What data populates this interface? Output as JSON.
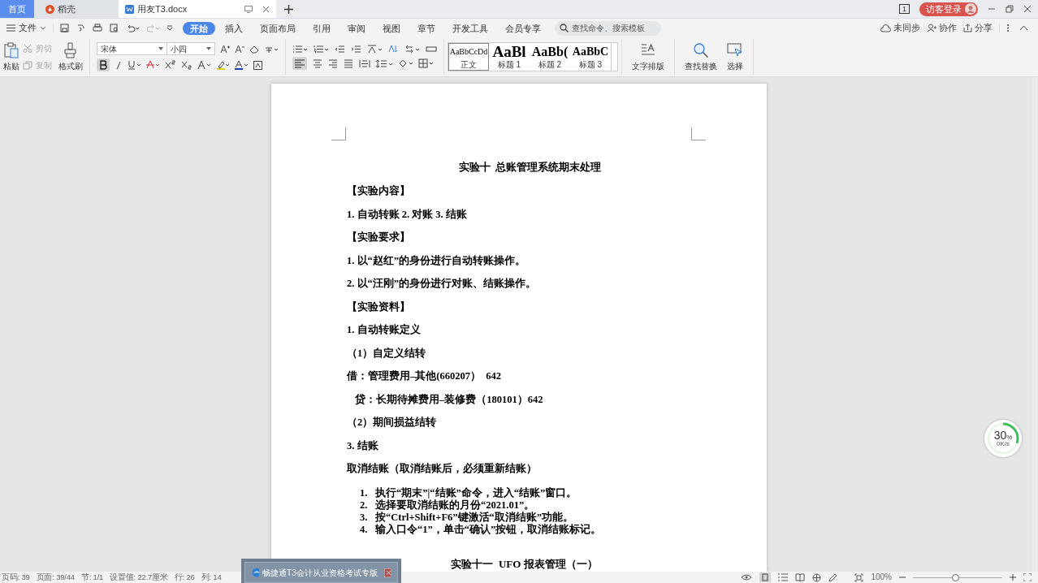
{
  "title_tabs": [
    {
      "label": "首页",
      "kind": "home",
      "selected": false
    },
    {
      "label": "稻壳",
      "kind": "docer",
      "selected": false
    },
    {
      "label": "用友T3.docx",
      "kind": "doc",
      "selected": true
    }
  ],
  "account": {
    "label": "访客登录",
    "page_count": "1"
  },
  "menu": {
    "file": "文件",
    "tabs": [
      {
        "label": "开始",
        "selected": true
      },
      {
        "label": "插入",
        "selected": false
      },
      {
        "label": "页面布局",
        "selected": false
      },
      {
        "label": "引用",
        "selected": false
      },
      {
        "label": "审阅",
        "selected": false
      },
      {
        "label": "视图",
        "selected": false
      },
      {
        "label": "章节",
        "selected": false
      },
      {
        "label": "开发工具",
        "selected": false
      },
      {
        "label": "会员专享",
        "selected": false
      }
    ],
    "search_placeholder": "查找命令、搜索模板",
    "actions": [
      "未同步",
      "协作",
      "分享"
    ]
  },
  "ribbon": {
    "paste": "粘贴",
    "cut": "剪切",
    "copy": "复制",
    "format_painter": "格式刷",
    "font": "宋体",
    "size": "小四",
    "styles": [
      {
        "preview": "AaBbCcDd",
        "label": "正文",
        "selected": true
      },
      {
        "preview": "AaBl",
        "label": "标题 1",
        "selected": false
      },
      {
        "preview": "AaBb(",
        "label": "标题 2",
        "selected": false
      },
      {
        "preview": "AaBbC",
        "label": "标题 3",
        "selected": false
      }
    ],
    "layout": "文字排版",
    "find": "查找替换",
    "select": "选择"
  },
  "document": [
    {
      "kind": "title",
      "text": "实验十  总账管理系统期末处理"
    },
    {
      "kind": "para",
      "text": "【实验内容】"
    },
    {
      "kind": "para",
      "text": "1. 自动转账 2. 对账 3. 结账"
    },
    {
      "kind": "para",
      "text": "【实验要求】"
    },
    {
      "kind": "para",
      "text": "1. 以“赵红”的身份进行自动转账操作。"
    },
    {
      "kind": "para",
      "text": "2. 以“汪刚”的身份进行对账、结账操作。"
    },
    {
      "kind": "para",
      "text": "【实验资料】"
    },
    {
      "kind": "para",
      "text": "1. 自动转账定义"
    },
    {
      "kind": "para",
      "text": "（1）自定义结转"
    },
    {
      "kind": "para",
      "text": "借：管理费用–其他(660207）  642"
    },
    {
      "kind": "indent",
      "text": "贷：长期待摊费用–装修费（180101）642"
    },
    {
      "kind": "para",
      "text": "（2）期间损益结转"
    },
    {
      "kind": "para",
      "text": "3. 结账"
    },
    {
      "kind": "para",
      "text": "取消结账（取消结账后，必须重新结账）"
    },
    {
      "kind": "list",
      "items": [
        {
          "num": "1.",
          "text": "执行“期末”|“结账”命令，进入“结账”窗口。"
        },
        {
          "num": "2.",
          "text": "选择要取消结账的月份“2021.01”。"
        },
        {
          "num": "3.",
          "text": "按“Ctrl+Shift+F6”键激活“取消结账”功能。"
        },
        {
          "num": "4.",
          "text": "输入口令“1”，单击“确认”按钮，取消结账标记。"
        }
      ]
    },
    {
      "kind": "next_title",
      "text": "实验十一  UFO 报表管理（一）"
    }
  ],
  "status_bar": [
    "页码: 39",
    "页面: 39/44",
    "节: 1/1",
    "设置值: 22.7厘米",
    "行: 26",
    "列: 14"
  ],
  "zoom": {
    "reading": "100%",
    "level": 0.47
  },
  "speed_widget": {
    "percent": "30",
    "unit": "%",
    "rate": "0K/s",
    "level": 0.3
  },
  "popup": {
    "title": "畅捷通T3会计从业资格考试专版"
  }
}
